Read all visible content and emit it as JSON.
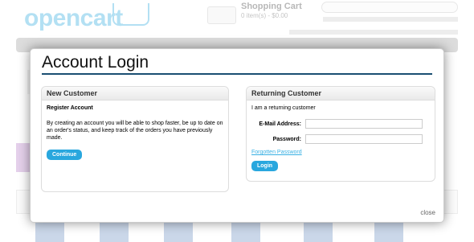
{
  "background": {
    "logo": "opencart",
    "cart_title": "Shopping Cart",
    "cart_summary": "0 item(s) - $0.00"
  },
  "modal": {
    "title": "Account Login",
    "close_label": "close"
  },
  "new_customer": {
    "heading": "New Customer",
    "subheading": "Register Account",
    "description": "By creating an account you will be able to shop faster, be up to date on an order's status, and keep track of the orders you have previously made.",
    "continue_label": "Continue"
  },
  "returning_customer": {
    "heading": "Returning Customer",
    "intro": "I am a returning customer",
    "email_label": "E-Mail Address:",
    "email_value": "",
    "password_label": "Password:",
    "password_value": "",
    "forgotten_label": "Forgotten Password",
    "login_label": "Login"
  },
  "colors": {
    "accent": "#29a7de",
    "title_rule": "#1b4f72",
    "link": "#38b0e3"
  }
}
